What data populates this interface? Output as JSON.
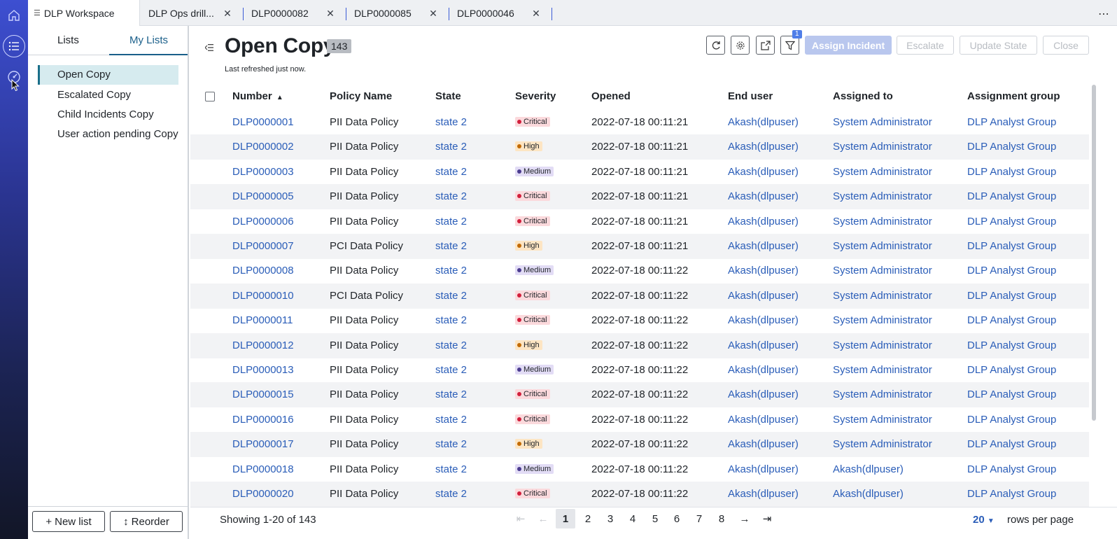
{
  "tabs": [
    {
      "label": "DLP Workspace",
      "closable": false
    },
    {
      "label": "DLP Ops drill...",
      "closable": true
    },
    {
      "label": "DLP0000082",
      "closable": true
    },
    {
      "label": "DLP0000085",
      "closable": true
    },
    {
      "label": "DLP0000046",
      "closable": true
    }
  ],
  "sidebar": {
    "tabs": [
      "Lists",
      "My Lists"
    ],
    "active_tab": "My Lists",
    "items": [
      "Open Copy",
      "Escalated Copy",
      "Child Incidents Copy",
      "User action pending Copy"
    ],
    "selected": "Open Copy",
    "new_list_label": "New list",
    "reorder_label": "Reorder"
  },
  "header": {
    "title": "Open Copy",
    "count": "143",
    "refreshed": "Last refreshed just now.",
    "filter_count": "1",
    "assign_label": "Assign Incident",
    "escalate_label": "Escalate",
    "update_label": "Update State",
    "close_label": "Close"
  },
  "table": {
    "columns": [
      "Number",
      "Policy Name",
      "State",
      "Severity",
      "Opened",
      "End user",
      "Assigned to",
      "Assignment group"
    ],
    "sort_column": "Number",
    "sort_dir": "asc",
    "rows": [
      [
        "DLP0000001",
        "PII Data Policy",
        "state 2",
        "Critical",
        "2022-07-18 00:11:21",
        "Akash(dlpuser)",
        "System Administrator",
        "DLP Analyst Group"
      ],
      [
        "DLP0000002",
        "PII Data Policy",
        "state 2",
        "High",
        "2022-07-18 00:11:21",
        "Akash(dlpuser)",
        "System Administrator",
        "DLP Analyst Group"
      ],
      [
        "DLP0000003",
        "PII Data Policy",
        "state 2",
        "Medium",
        "2022-07-18 00:11:21",
        "Akash(dlpuser)",
        "System Administrator",
        "DLP Analyst Group"
      ],
      [
        "DLP0000005",
        "PII Data Policy",
        "state 2",
        "Critical",
        "2022-07-18 00:11:21",
        "Akash(dlpuser)",
        "System Administrator",
        "DLP Analyst Group"
      ],
      [
        "DLP0000006",
        "PII Data Policy",
        "state 2",
        "Critical",
        "2022-07-18 00:11:21",
        "Akash(dlpuser)",
        "System Administrator",
        "DLP Analyst Group"
      ],
      [
        "DLP0000007",
        "PCI Data Policy",
        "state 2",
        "High",
        "2022-07-18 00:11:21",
        "Akash(dlpuser)",
        "System Administrator",
        "DLP Analyst Group"
      ],
      [
        "DLP0000008",
        "PII Data Policy",
        "state 2",
        "Medium",
        "2022-07-18 00:11:22",
        "Akash(dlpuser)",
        "System Administrator",
        "DLP Analyst Group"
      ],
      [
        "DLP0000010",
        "PCI Data Policy",
        "state 2",
        "Critical",
        "2022-07-18 00:11:22",
        "Akash(dlpuser)",
        "System Administrator",
        "DLP Analyst Group"
      ],
      [
        "DLP0000011",
        "PII Data Policy",
        "state 2",
        "Critical",
        "2022-07-18 00:11:22",
        "Akash(dlpuser)",
        "System Administrator",
        "DLP Analyst Group"
      ],
      [
        "DLP0000012",
        "PII Data Policy",
        "state 2",
        "High",
        "2022-07-18 00:11:22",
        "Akash(dlpuser)",
        "System Administrator",
        "DLP Analyst Group"
      ],
      [
        "DLP0000013",
        "PII Data Policy",
        "state 2",
        "Medium",
        "2022-07-18 00:11:22",
        "Akash(dlpuser)",
        "System Administrator",
        "DLP Analyst Group"
      ],
      [
        "DLP0000015",
        "PII Data Policy",
        "state 2",
        "Critical",
        "2022-07-18 00:11:22",
        "Akash(dlpuser)",
        "System Administrator",
        "DLP Analyst Group"
      ],
      [
        "DLP0000016",
        "PII Data Policy",
        "state 2",
        "Critical",
        "2022-07-18 00:11:22",
        "Akash(dlpuser)",
        "System Administrator",
        "DLP Analyst Group"
      ],
      [
        "DLP0000017",
        "PII Data Policy",
        "state 2",
        "High",
        "2022-07-18 00:11:22",
        "Akash(dlpuser)",
        "System Administrator",
        "DLP Analyst Group"
      ],
      [
        "DLP0000018",
        "PII Data Policy",
        "state 2",
        "Medium",
        "2022-07-18 00:11:22",
        "Akash(dlpuser)",
        "Akash(dlpuser)",
        "DLP Analyst Group"
      ],
      [
        "DLP0000020",
        "PII Data Policy",
        "state 2",
        "Critical",
        "2022-07-18 00:11:22",
        "Akash(dlpuser)",
        "Akash(dlpuser)",
        "DLP Analyst Group"
      ]
    ]
  },
  "severity_colors": {
    "Critical": {
      "bg": "#fbd9dc",
      "dot": "#d21f3c"
    },
    "High": {
      "bg": "#fde5c3",
      "dot": "#c26a00"
    },
    "Medium": {
      "bg": "#e2dcf5",
      "dot": "#4b3c8f"
    }
  },
  "pagination": {
    "showing": "Showing 1-20 of 143",
    "pages": [
      "1",
      "2",
      "3",
      "4",
      "5",
      "6",
      "7",
      "8"
    ],
    "current": "1",
    "rows_per_page": "20",
    "rows_per_page_label": "rows per page"
  },
  "colors": {
    "link": "#2a5db8",
    "accent": "#1a5f8a",
    "primary_disabled": "#b9c7ee"
  }
}
